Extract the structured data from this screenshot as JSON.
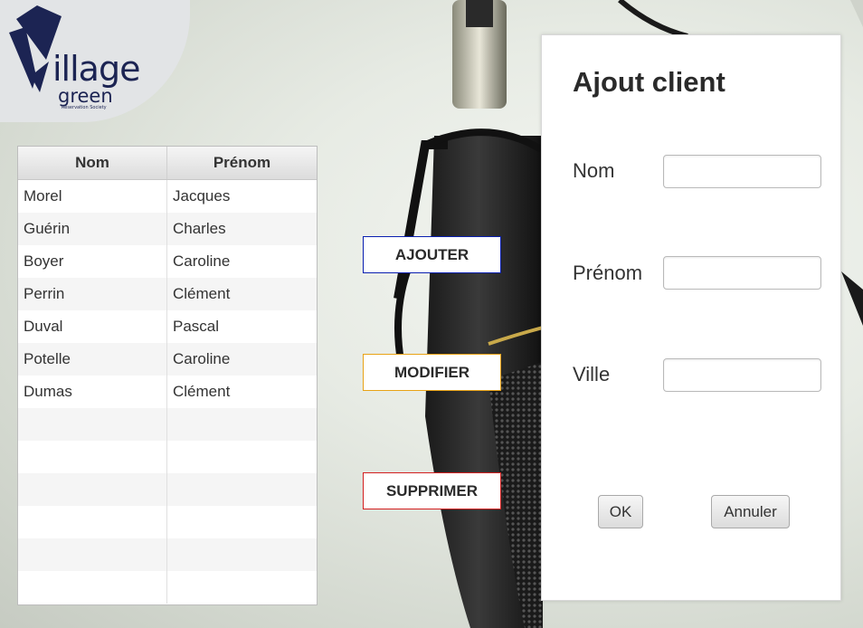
{
  "logo": {
    "word": "illage",
    "sub": "green",
    "tagline": "Reservation Society"
  },
  "table": {
    "columns": [
      "Nom",
      "Prénom"
    ],
    "rows": [
      [
        "Morel",
        "Jacques"
      ],
      [
        "Guérin",
        "Charles"
      ],
      [
        "Boyer",
        "Caroline"
      ],
      [
        "Perrin",
        "Clément"
      ],
      [
        "Duval",
        "Pascal"
      ],
      [
        "Potelle",
        "Caroline"
      ],
      [
        "Dumas",
        "Clément"
      ]
    ],
    "empty_rows": 6
  },
  "actions": {
    "add_label": "AJOUTER",
    "edit_label": "MODIFIER",
    "delete_label": "SUPPRIMER"
  },
  "form": {
    "title": "Ajout client",
    "nom_label": "Nom",
    "nom_value": "",
    "prenom_label": "Prénom",
    "prenom_value": "",
    "ville_label": "Ville",
    "ville_value": "",
    "ok_label": "OK",
    "cancel_label": "Annuler"
  },
  "colors": {
    "add_border": "#0a1fb0",
    "edit_border": "#e8a317",
    "delete_border": "#d31f1f",
    "brand": "#1c2453"
  }
}
